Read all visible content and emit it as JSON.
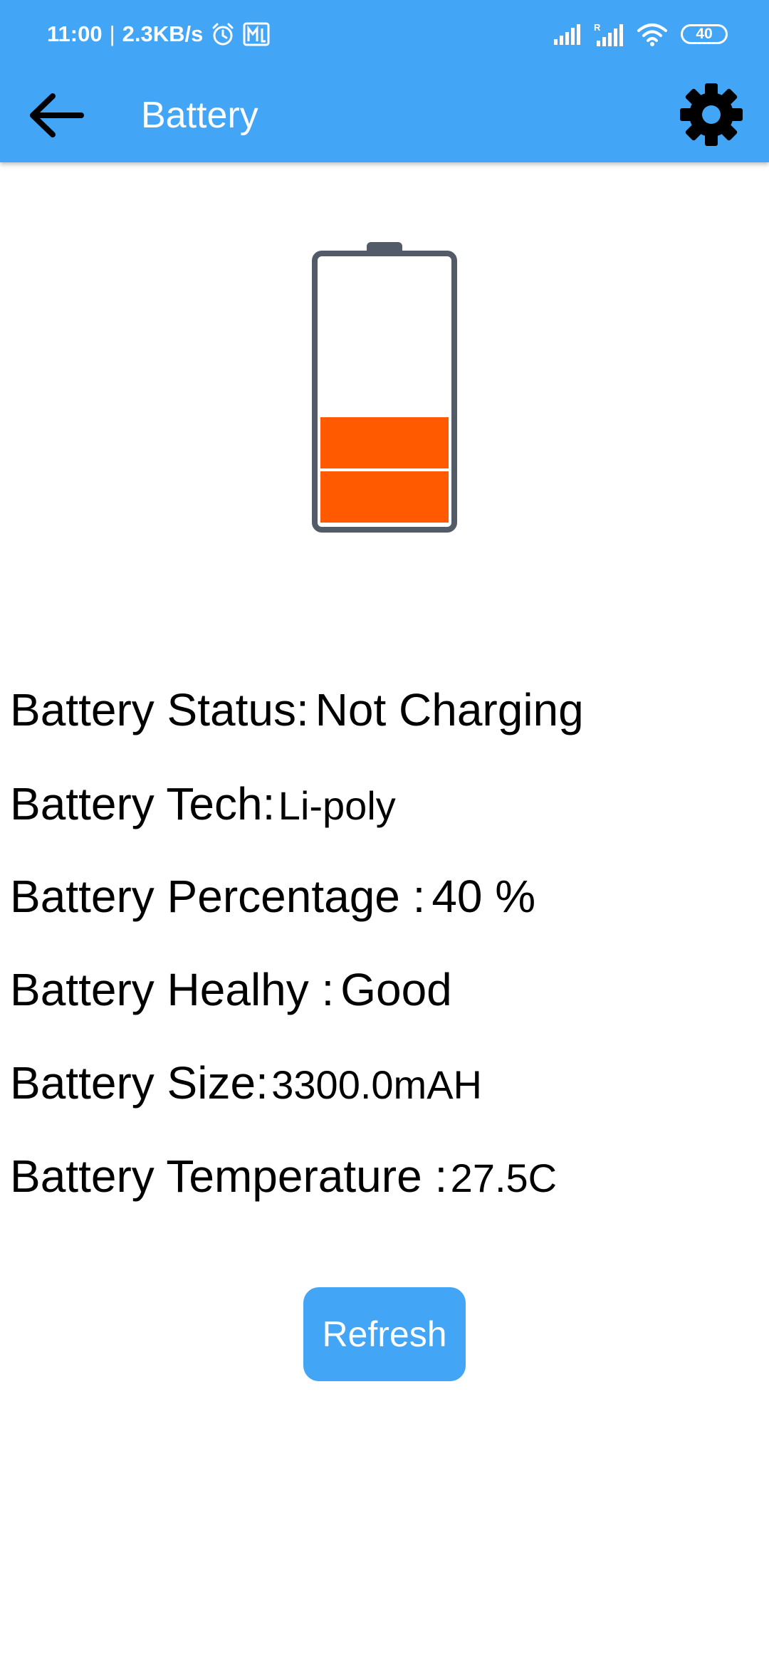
{
  "status_bar": {
    "time": "11:00",
    "separator": "|",
    "net_speed": "2.3KB/s",
    "battery_level": "40",
    "icons": [
      "alarm-icon",
      "mi-icon",
      "signal-icon",
      "roaming-signal-icon",
      "wifi-icon",
      "battery-icon"
    ]
  },
  "toolbar": {
    "title": "Battery",
    "back_icon": "arrow-left-icon",
    "settings_icon": "gear-icon"
  },
  "battery_graphic": {
    "level_percent": 40,
    "fill_color": "#ff5a00",
    "outline_color": "#525b67"
  },
  "info": {
    "status_label": "Battery Status:",
    "status_value": "Not Charging",
    "tech_label": "Battery Tech:",
    "tech_value": "Li-poly",
    "percentage_label": "Battery Percentage :",
    "percentage_value": "40 %",
    "health_label": "Battery Healhy :",
    "health_value": "Good",
    "size_label": "Battery Size:",
    "size_value": "3300.0mAH",
    "temperature_label": "Battery Temperature :",
    "temperature_value": "27.5C"
  },
  "actions": {
    "refresh_label": "Refresh"
  },
  "colors": {
    "app_bar": "#42a5f5",
    "button": "#42a5f5"
  }
}
